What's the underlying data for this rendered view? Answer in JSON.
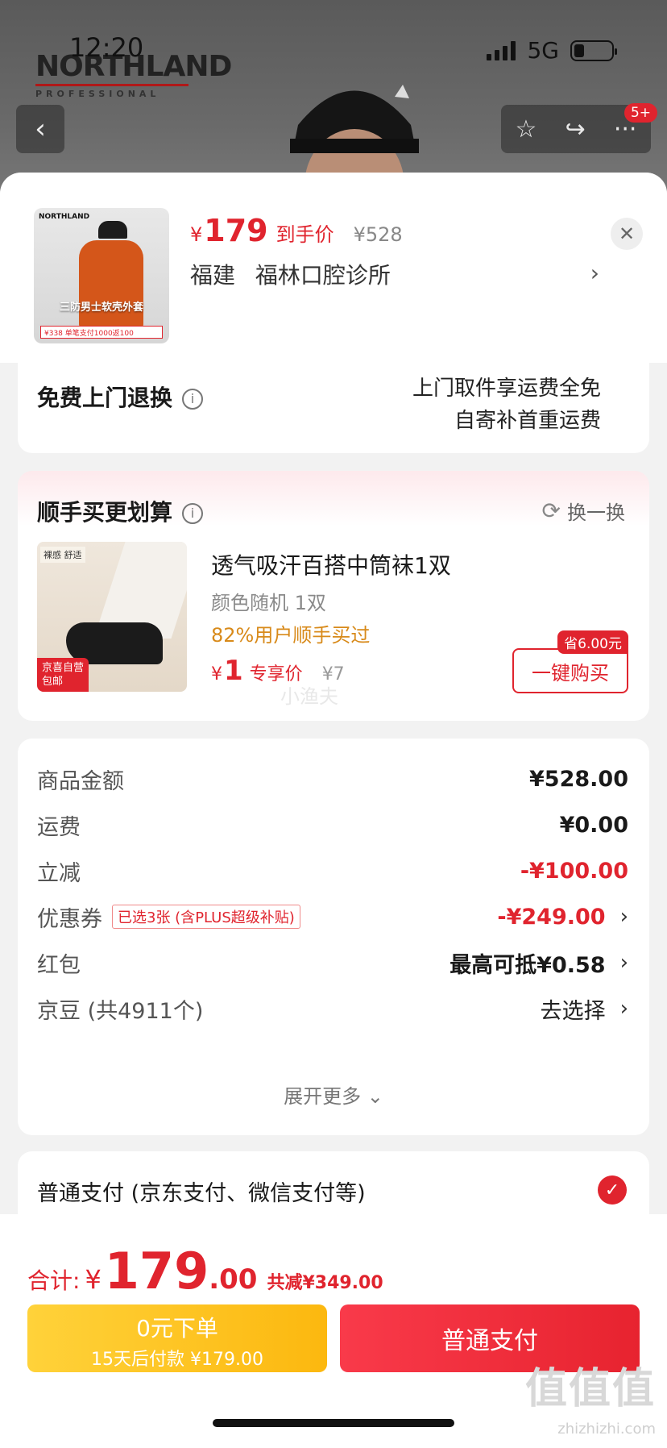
{
  "status_bar": {
    "time": "12:20",
    "network": "5G"
  },
  "background": {
    "brand": "NORTHLAND",
    "brand_sub": "PROFESSIONAL",
    "badge": "5+",
    "back_glyph": "‹",
    "star_glyph": "☆",
    "share_glyph": "↪",
    "more_glyph": "···"
  },
  "product": {
    "currency": "¥",
    "price": "179",
    "price_label": "到手价",
    "orig_price": "¥528",
    "province": "福建",
    "store": "福林口腔诊所",
    "thumb_brand": "NORTHLAND",
    "thumb_text": "三防男士软壳外套",
    "thumb_price_line": "¥338  单笔支付1000返100",
    "close_glyph": "✕"
  },
  "returns": {
    "title": "免费上门退换",
    "line1": "上门取件享运费全免",
    "line2": "自寄补首重运费"
  },
  "addon": {
    "title": "顺手买更划算",
    "swap_label": "换一换",
    "name": "透气吸汗百搭中筒袜1双",
    "spec": "颜色随机 1双",
    "bought": "82%用户顺手买过",
    "currency": "¥",
    "price": "1",
    "price_label": "专享价",
    "orig_price": "¥7",
    "buy_label": "一键购买",
    "save_tag": "省6.00元",
    "thumb_tag": "裸感 舒适",
    "thumb_badge_1": "京喜自营",
    "thumb_badge_2": "包邮",
    "watermark": "小渔夫"
  },
  "summary": {
    "rows": [
      {
        "label": "商品金额",
        "value": "¥528.00"
      },
      {
        "label": "运费",
        "value": "¥0.00"
      },
      {
        "label": "立减",
        "value": "-¥100.00"
      },
      {
        "label": "优惠券",
        "tag": "已选3张 (含PLUS超级补贴)",
        "value": "-¥249.00"
      },
      {
        "label": "红包",
        "value": "最高可抵¥0.58"
      },
      {
        "label": "京豆 (共4911个)",
        "value": "去选择"
      }
    ],
    "expand_label": "展开更多 ⌄"
  },
  "payment": {
    "method": "普通支付 (京东支付、微信支付等)"
  },
  "total": {
    "label": "合计:",
    "currency": "¥",
    "int": "179",
    "dec": ".00",
    "saved": "共减¥349.00"
  },
  "buttons": {
    "later_main": "0元下单",
    "later_sub": "15天后付款 ¥179.00",
    "pay": "普通支付"
  },
  "watermark": {
    "brand": "值值值",
    "url": "zhizhizhi.com"
  },
  "colors": {
    "accent": "#e0242e",
    "later_btn": "#fcb80f",
    "bought_text": "#d88a1a"
  }
}
